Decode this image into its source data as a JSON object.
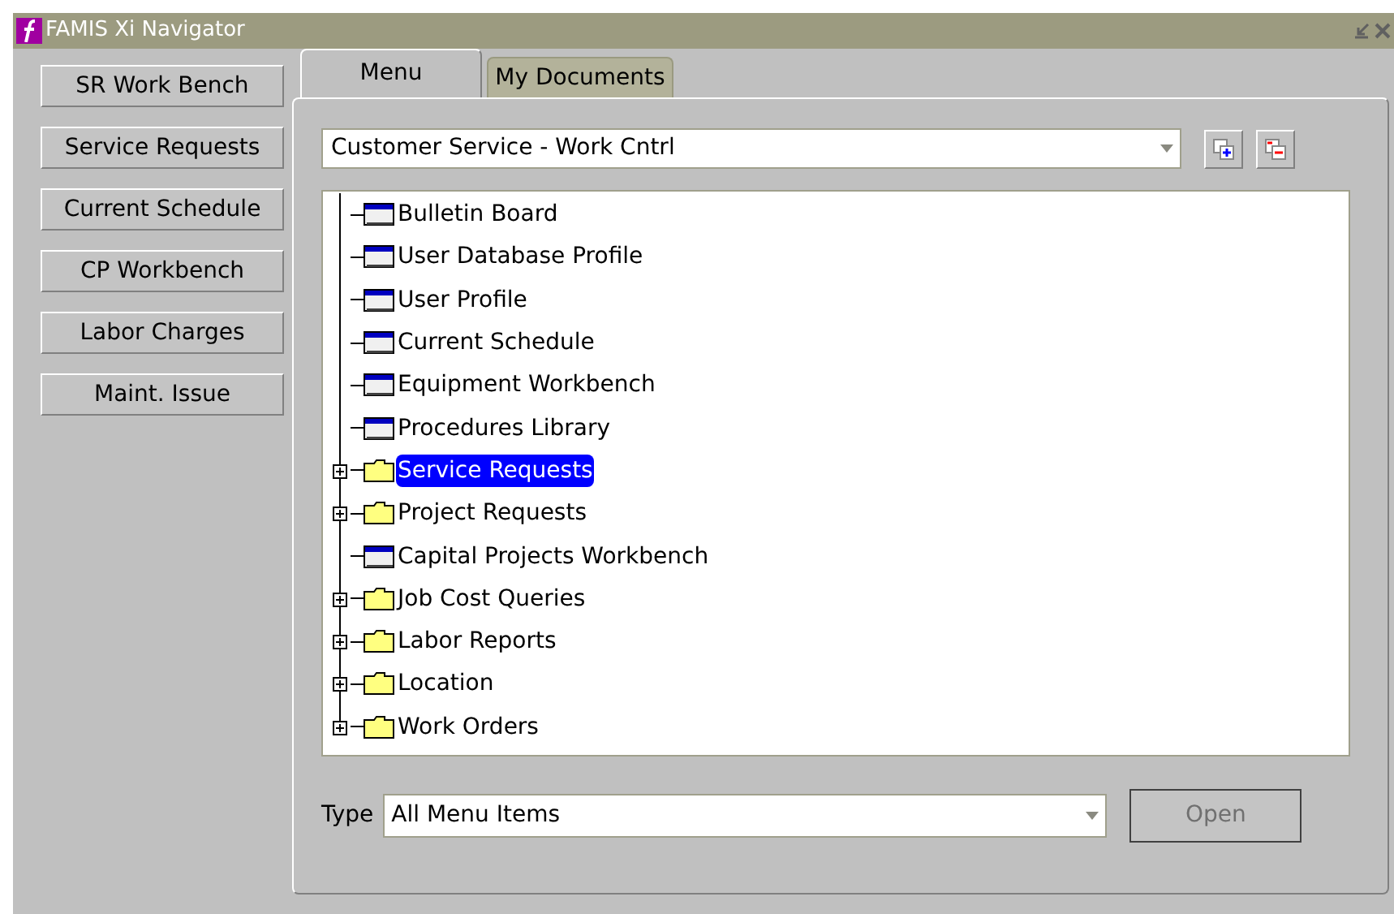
{
  "window": {
    "title": "FAMIS Xi Navigator"
  },
  "sidebar": {
    "buttons": [
      "SR Work Bench",
      "Service Requests",
      "Current Schedule",
      "CP Workbench",
      "Labor Charges",
      "Maint. Issue"
    ]
  },
  "tabs": [
    {
      "label": "Menu",
      "selected": true
    },
    {
      "label": "My Documents",
      "selected": false
    }
  ],
  "menu_select": {
    "value": "Customer Service - Work Cntrl"
  },
  "tree": {
    "items": [
      {
        "label": "Bulletin Board",
        "kind": "form",
        "selected": false
      },
      {
        "label": "User Database Profile",
        "kind": "form",
        "selected": false
      },
      {
        "label": "User Profile",
        "kind": "form",
        "selected": false
      },
      {
        "label": "Current Schedule",
        "kind": "form",
        "selected": false
      },
      {
        "label": "Equipment Workbench",
        "kind": "form",
        "selected": false
      },
      {
        "label": "Procedures Library",
        "kind": "form",
        "selected": false
      },
      {
        "label": "Service Requests",
        "kind": "folder",
        "selected": true
      },
      {
        "label": "Project Requests",
        "kind": "folder",
        "selected": false
      },
      {
        "label": "Capital Projects Workbench",
        "kind": "form",
        "selected": false
      },
      {
        "label": "Job Cost Queries",
        "kind": "folder",
        "selected": false
      },
      {
        "label": "Labor Reports",
        "kind": "folder",
        "selected": false
      },
      {
        "label": "Location",
        "kind": "folder",
        "selected": false
      },
      {
        "label": "Work Orders",
        "kind": "folder",
        "selected": false
      }
    ]
  },
  "type_select": {
    "label": "Type",
    "value": "All Menu Items"
  },
  "open_button": {
    "label": "Open",
    "disabled": true
  }
}
